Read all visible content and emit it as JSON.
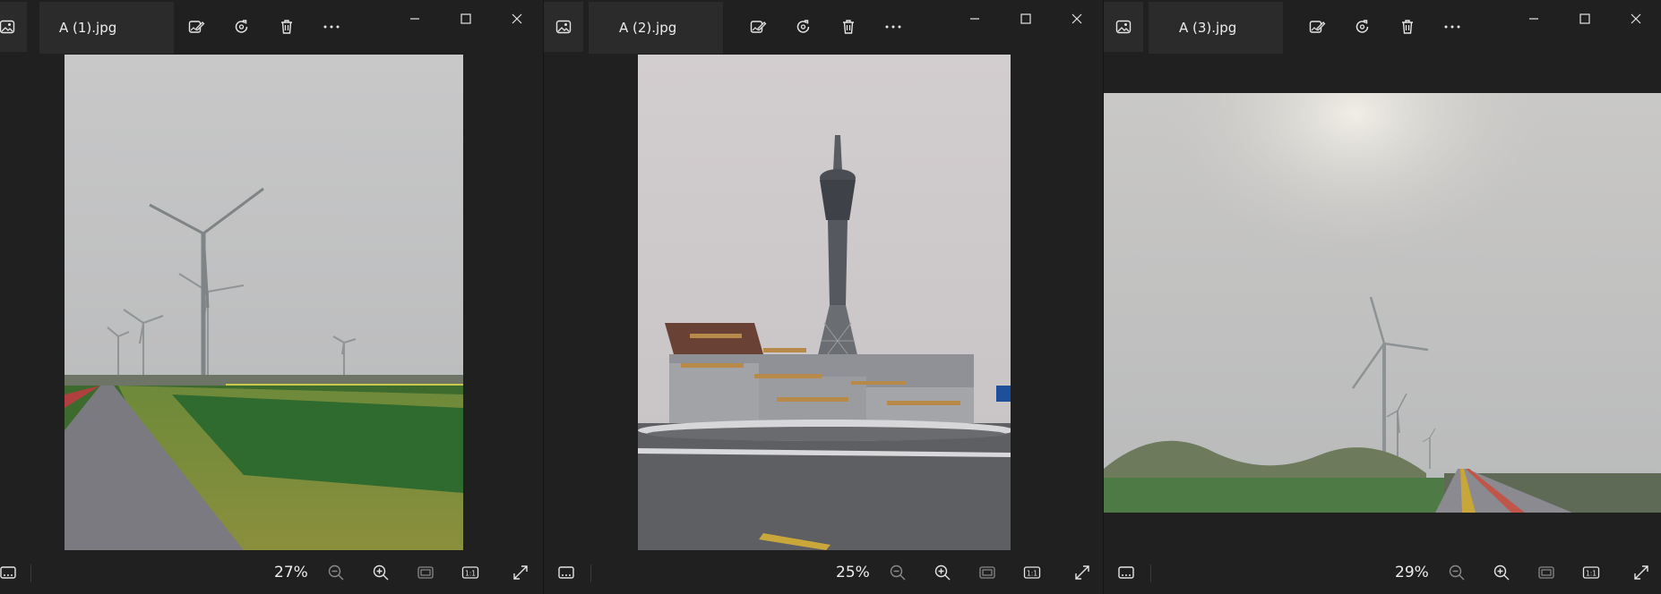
{
  "windows": [
    {
      "file_name": "A (1).jpg",
      "zoom": "27%"
    },
    {
      "file_name": "A (2).jpg",
      "zoom": "25%"
    },
    {
      "file_name": "A (3).jpg",
      "zoom": "29%"
    }
  ],
  "toolbar": {
    "edit_icon": "edit-image-icon",
    "rotate_icon": "rotate-icon",
    "delete_icon": "trash-icon",
    "more_icon": "more-ellipsis-icon"
  },
  "footer": {
    "one_to_one_label": "1:1"
  },
  "colors": {
    "background": "#202020",
    "panel": "#2b2b2b",
    "text": "#ededed"
  }
}
